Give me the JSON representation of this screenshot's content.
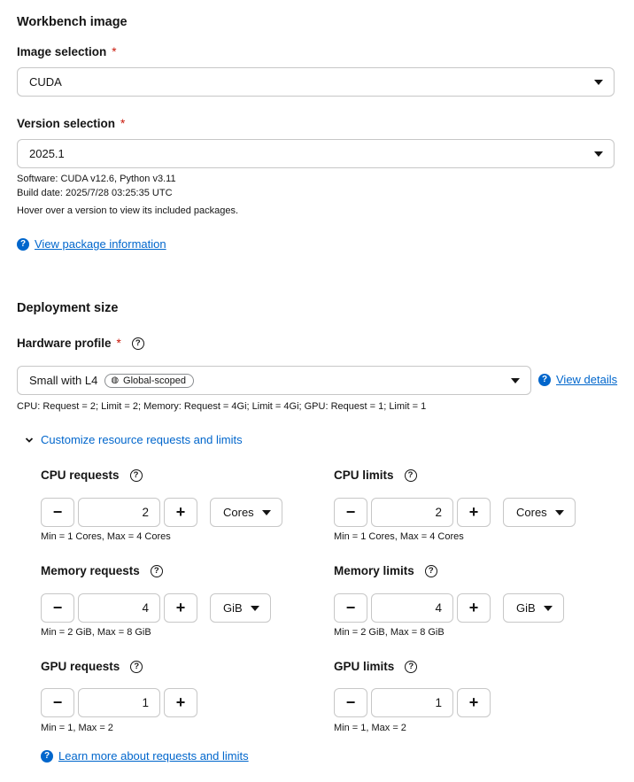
{
  "workbench_image": {
    "title": "Workbench image",
    "image_selection": {
      "label": "Image selection",
      "required_mark": "*",
      "value": "CUDA"
    },
    "version_selection": {
      "label": "Version selection",
      "required_mark": "*",
      "value": "2025.1"
    },
    "software": "Software: CUDA v12.6, Python v3.11",
    "build_date": "Build date: 2025/7/28 03:25:35 UTC",
    "hover_hint": "Hover over a version to view its included packages.",
    "package_link": "View package information"
  },
  "deployment_size": {
    "title": "Deployment size",
    "hardware_profile": {
      "label": "Hardware profile",
      "required_mark": "*",
      "value": "Small with L4",
      "badge": "Global-scoped",
      "details_link": "View details",
      "summary": "CPU: Request = 2; Limit = 2; Memory: Request = 4Gi; Limit = 4Gi; GPU: Request = 1; Limit = 1"
    },
    "customize_toggle": "Customize resource requests and limits",
    "cpu_requests": {
      "label": "CPU requests",
      "value": "2",
      "unit": "Cores",
      "helper": "Min = 1 Cores, Max = 4 Cores"
    },
    "cpu_limits": {
      "label": "CPU limits",
      "value": "2",
      "unit": "Cores",
      "helper": "Min = 1 Cores, Max = 4 Cores"
    },
    "memory_requests": {
      "label": "Memory requests",
      "value": "4",
      "unit": "GiB",
      "helper": "Min = 2 GiB, Max = 8 GiB"
    },
    "memory_limits": {
      "label": "Memory limits",
      "value": "4",
      "unit": "GiB",
      "helper": "Min = 2 GiB, Max = 8 GiB"
    },
    "gpu_requests": {
      "label": "GPU requests",
      "value": "1",
      "helper": "Min = 1, Max = 2"
    },
    "gpu_limits": {
      "label": "GPU limits",
      "value": "1",
      "helper": "Min = 1, Max = 2"
    },
    "learn_more_link": "Learn more about requests and limits"
  },
  "icons": {
    "minus": "−",
    "plus": "+",
    "question": "?",
    "chevron_down": "⌄",
    "globe": "🌐"
  },
  "colors": {
    "link": "#0066cc",
    "required": "#c9190b",
    "border": "#c7c7c7"
  }
}
